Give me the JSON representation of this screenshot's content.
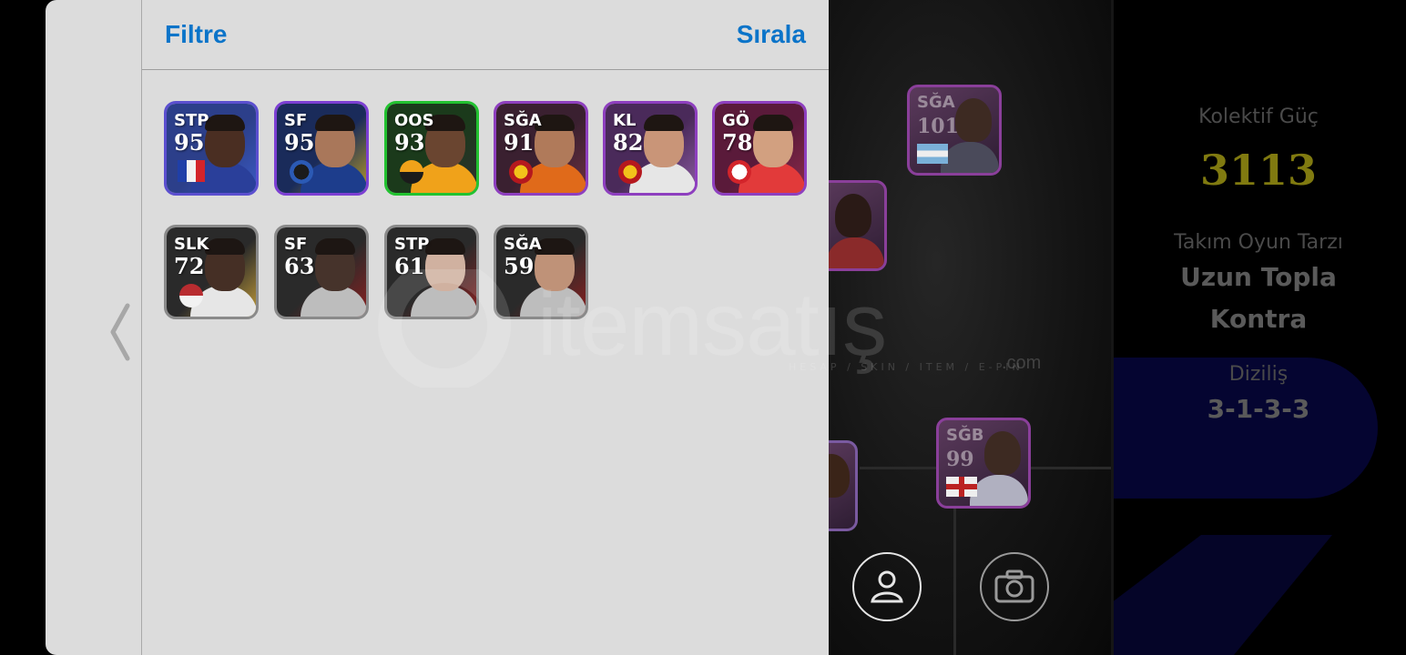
{
  "panel": {
    "filter_label": "Filtre",
    "sort_label": "Sırala",
    "cards": [
      {
        "position": "STP",
        "rating": "95",
        "border": "#5b4fcf",
        "bg": "#2c3f8a",
        "bg2": "#3a5ac2",
        "skin": "#4a2e22",
        "shirt": "#2a3f9a",
        "badge": "france-flag-icon"
      },
      {
        "position": "SF",
        "rating": "95",
        "border": "#7c3fd3",
        "bg": "#1a2b5a",
        "bg2": "#b59a28",
        "skin": "#a9775a",
        "shirt": "#1d3d8c",
        "badge": "inter-crest-icon"
      },
      {
        "position": "OOS",
        "rating": "93",
        "border": "#22c230",
        "bg": "#1b3a1b",
        "bg2": "#2f2f2f",
        "skin": "#6a4530",
        "shirt": "#f0a21a",
        "badge": "club-crest-icon"
      },
      {
        "position": "SĞA",
        "rating": "91",
        "border": "#8e3fbf",
        "bg": "#3a2030",
        "bg2": "#6a3040",
        "skin": "#b07a5a",
        "shirt": "#e06a1a",
        "badge": "galatasaray-crest-icon"
      },
      {
        "position": "KL",
        "rating": "82",
        "border": "#8e3fbf",
        "bg": "#4a2a5a",
        "bg2": "#8a5aa0",
        "skin": "#c99578",
        "shirt": "#e6e6e6",
        "badge": "galatasaray-crest-icon"
      },
      {
        "position": "GÖ",
        "rating": "78",
        "border": "#8e3fbf",
        "bg": "#5a1a3a",
        "bg2": "#8a2a4a",
        "skin": "#d2a080",
        "shirt": "#e23a3a",
        "badge": "antalyaspor-crest-icon"
      },
      {
        "position": "SLK",
        "rating": "72",
        "border": "#8a8a8a",
        "bg": "#2a2a2a",
        "bg2": "#c99a20",
        "skin": "#4a2e22",
        "shirt": "#e6e6e6",
        "badge": "braga-crest-icon"
      },
      {
        "position": "SF",
        "rating": "63",
        "border": "#8a8a8a",
        "bg": "#2a2a2a",
        "bg2": "#a01a1a",
        "skin": "#4a3228",
        "shirt": "#bdbdbd",
        "badge": ""
      },
      {
        "position": "STP",
        "rating": "61",
        "border": "#8a8a8a",
        "bg": "#2a2a2a",
        "bg2": "#a01a1a",
        "skin": "#d6b09a",
        "shirt": "#bdbdbd",
        "badge": ""
      },
      {
        "position": "SĞA",
        "rating": "59",
        "border": "#8a8a8a",
        "bg": "#2a2a2a",
        "bg2": "#a01a1a",
        "skin": "#c89070",
        "shirt": "#bdbdbd",
        "badge": ""
      }
    ]
  },
  "field": {
    "cards": [
      {
        "position": "SĞA",
        "rating": "101",
        "flag": "argentina-flag-icon"
      },
      {
        "position": "",
        "rating": "",
        "flag": ""
      },
      {
        "position": "SĞB",
        "rating": "99",
        "flag": "england-flag-icon"
      },
      {
        "position": "",
        "rating": "",
        "flag": ""
      }
    ],
    "profile_button": "person-icon",
    "camera_button": "camera-icon"
  },
  "stats": {
    "team_power_label": "Kolektif Güç",
    "team_power_value": "3113",
    "playstyle_label": "Takım Oyun Tarzı",
    "playstyle_line1": "Uzun Topla",
    "playstyle_line2": "Kontra",
    "formation_label": "Diziliş",
    "formation_value": "3-1-3-3"
  },
  "watermark": {
    "brand": "itemsatış",
    "tagline": "HESAP / SKIN / ITEM / E-PIN",
    "tld": ".com"
  }
}
